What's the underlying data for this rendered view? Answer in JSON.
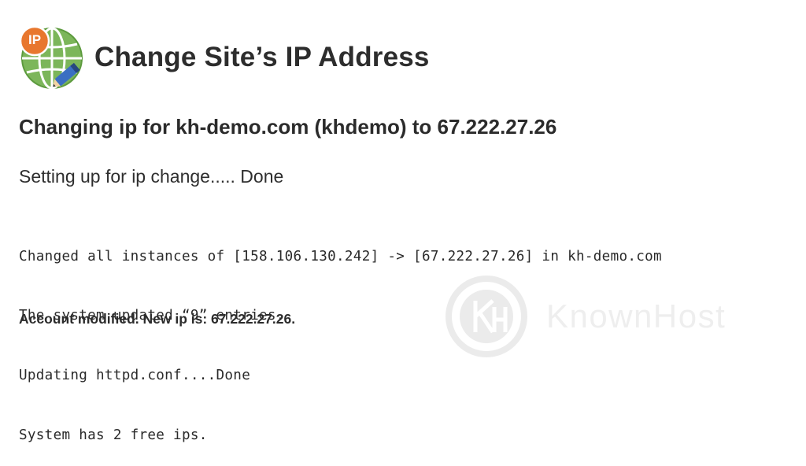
{
  "header": {
    "icon_badge": "IP",
    "title": "Change Site’s IP Address"
  },
  "main": {
    "subtitle": "Changing ip for kh-demo.com (khdemo) to 67.222.27.26",
    "setup_line": "Setting up for ip change..... Done",
    "log_lines": [
      "Changed all instances of [158.106.130.242] -> [67.222.27.26] in kh-demo.com",
      "The system updated “9” entries.",
      "Updating httpd.conf....Done",
      "System has 2 free ips."
    ],
    "result": "Account modified. New ip is: 67.222.27.26."
  },
  "watermark": {
    "text": "KnownHost"
  },
  "colors": {
    "globe_green": "#6fae4a",
    "badge_orange": "#e8772e",
    "text": "#2b2b2b"
  }
}
